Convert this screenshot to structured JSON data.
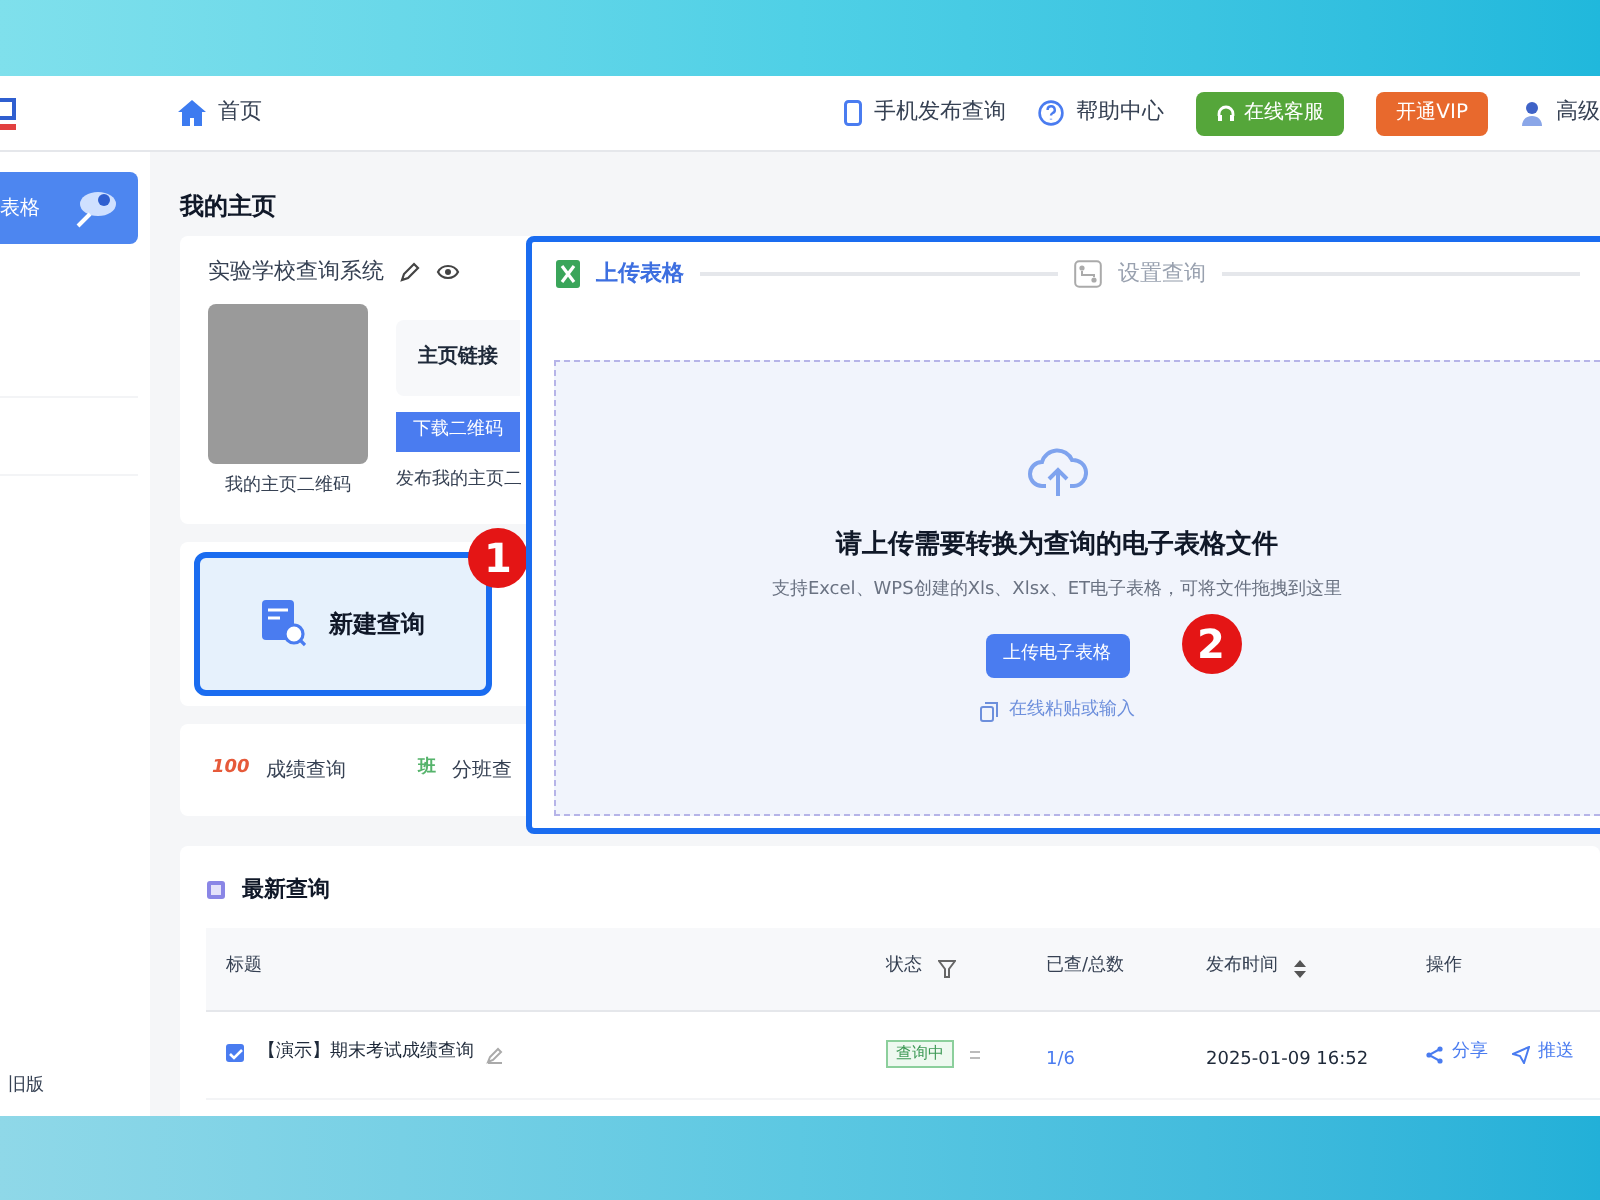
{
  "header": {
    "breadcrumb": "首页",
    "links": [
      {
        "kind": "phone",
        "label": "手机发布查询"
      },
      {
        "kind": "help",
        "label": "帮助中心"
      },
      {
        "kind": "service",
        "label": "在线客服"
      },
      {
        "kind": "vip",
        "label": "开通VIP"
      },
      {
        "kind": "user",
        "label": "高级"
      }
    ]
  },
  "sidebar": {
    "banner": "表格",
    "footer": "旧版"
  },
  "home": {
    "title": "我的主页",
    "site_name": "实验学校查询系统",
    "qr_caption": "我的主页二维码",
    "link_label": "主页链接",
    "download_button": "下载二维码",
    "publish_caption": "发布我的主页二"
  },
  "new_query": {
    "label": "新建查询",
    "highlighted": true,
    "step": "1"
  },
  "templates": [
    {
      "icon_text": "100",
      "label": "成绩查询"
    },
    {
      "icon_text": "班",
      "label": "分班查"
    }
  ],
  "upload": {
    "steps": [
      {
        "label": "上传表格",
        "selected": true
      },
      {
        "label": "设置查询",
        "selected": false
      }
    ],
    "heading": "请上传需要转换为查询的电子表格文件",
    "hint": "支持Excel、WPS创建的Xls、Xlsx、ET电子表格，可将文件拖拽到这里",
    "button": "上传电子表格",
    "step": "2",
    "paste_link": "在线粘贴或输入"
  },
  "recent": {
    "title": "最新查询",
    "columns": [
      {
        "label": "标题",
        "kind": "plain"
      },
      {
        "label": "状态",
        "kind": "filter"
      },
      {
        "label": "已查/总数",
        "kind": "plain"
      },
      {
        "label": "发布时间",
        "kind": "sort"
      },
      {
        "label": "操作",
        "kind": "plain"
      }
    ],
    "rows": [
      {
        "title": "【演示】期末考试成绩查询",
        "status": "查询中",
        "count": "1/6",
        "time": "2025-01-09 16:52",
        "actions": [
          "分享",
          "推送"
        ]
      }
    ]
  }
}
